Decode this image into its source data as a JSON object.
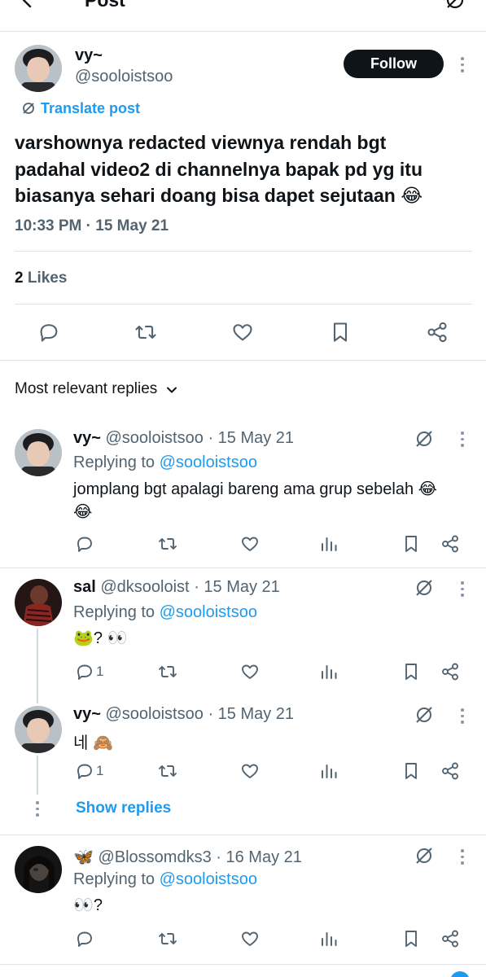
{
  "header": {
    "title": "Post",
    "back_icon": "back-arrow-icon",
    "grok_icon": "grok-icon"
  },
  "post": {
    "author_name": "vy~",
    "handle": "@sooloistsoo",
    "follow_label": "Follow",
    "translate_label": "Translate post",
    "text_lines": [
      "varshownya redacted viewnya rendah bgt",
      "padahal video2 di channelnya bapak pd yg itu",
      "biasanya sehari doang bisa dapet sejutaan 😂"
    ],
    "timestamp": "10:33 PM · 15 May 21",
    "likes_count": "2",
    "likes_label": "Likes"
  },
  "replies_filter": {
    "label": "Most relevant replies"
  },
  "replies": [
    {
      "name": "vy~",
      "handle": "@sooloistsoo",
      "date": "· 15 May 21",
      "replying_label": "Replying to",
      "replying_to": "@sooloistsoo",
      "text_lines": [
        "jomplang bgt apalagi bareng ama grup sebelah 😂",
        "😂"
      ]
    },
    {
      "name": "sal",
      "handle": "@dksooloist",
      "date": "· 15 May 21",
      "replying_label": "Replying to",
      "replying_to": "@sooloistsoo",
      "text": "🐸? 👀",
      "reply_count": "1"
    },
    {
      "name": "vy~",
      "handle": "@sooloistsoo",
      "date": "· 15 May 21",
      "text": "네 🙈",
      "reply_count": "1",
      "show_replies_label": "Show replies"
    },
    {
      "name": "🦋",
      "handle": "@Blossomdks3",
      "date": "· 16 May 21",
      "replying_label": "Replying to",
      "replying_to": "@sooloistsoo",
      "text": "👀?"
    }
  ],
  "colors": {
    "accent": "#1d9bf0",
    "text": "#0f1419",
    "secondary": "#536471",
    "divider": "#dfe3e7",
    "follow_bg": "#0f1419"
  }
}
